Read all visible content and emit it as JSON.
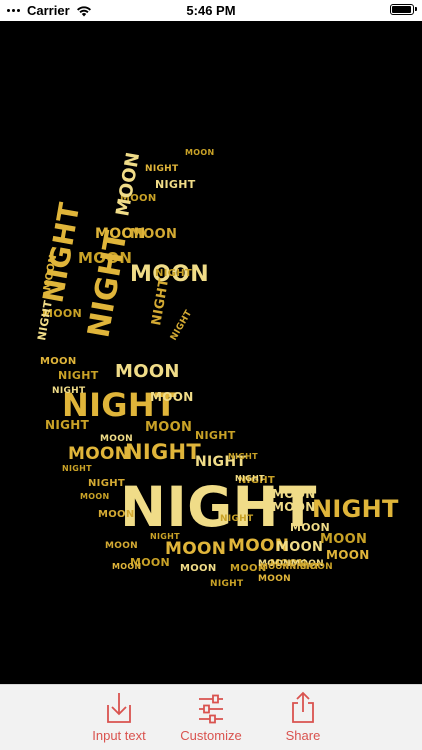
{
  "status_bar": {
    "carrier": "Carrier",
    "time": "5:46 PM",
    "battery_level": 0.95
  },
  "canvas": {
    "background": "#000000",
    "palette": [
      "#c9a227",
      "#e0b53a",
      "#f0dc88",
      "#d4aa33"
    ],
    "word_cloud": [
      {
        "text": "MOON"
      },
      {
        "text": "NIGHT"
      },
      {
        "text": "NIGHT"
      },
      {
        "text": "MOON"
      },
      {
        "text": "MOON"
      },
      {
        "text": "MOON"
      },
      {
        "text": "MOON"
      },
      {
        "text": "NIGHT"
      },
      {
        "text": "MOON"
      },
      {
        "text": "NIGHT"
      },
      {
        "text": "NIGHT"
      },
      {
        "text": "MOON"
      },
      {
        "text": "MOON"
      },
      {
        "text": "NIGHT"
      },
      {
        "text": "NIGHT"
      },
      {
        "text": "MOON"
      },
      {
        "text": "MOON"
      },
      {
        "text": "NIGHT"
      },
      {
        "text": "NIGHT"
      },
      {
        "text": "MOON"
      },
      {
        "text": "NIGHT"
      },
      {
        "text": "MOON"
      },
      {
        "text": "NIGHT"
      },
      {
        "text": "NIGHT"
      },
      {
        "text": "MOON"
      },
      {
        "text": "NIGHT"
      },
      {
        "text": "MOON"
      },
      {
        "text": "NIGHT"
      },
      {
        "text": "NIGHT"
      },
      {
        "text": "MOON"
      },
      {
        "text": "NIGHT"
      },
      {
        "text": "NIGHT"
      },
      {
        "text": "MOON"
      },
      {
        "text": "MOON"
      },
      {
        "text": "NIGHT"
      },
      {
        "text": "NIGHT"
      },
      {
        "text": "MOON"
      },
      {
        "text": "MOON"
      },
      {
        "text": "MOON"
      },
      {
        "text": "MOON"
      },
      {
        "text": "NIGHT"
      },
      {
        "text": "MOON"
      },
      {
        "text": "MOON"
      },
      {
        "text": "MOON"
      },
      {
        "text": "MOON"
      },
      {
        "text": "MOON"
      },
      {
        "text": "MOON"
      },
      {
        "text": "MOONMOON"
      },
      {
        "text": "MOON"
      },
      {
        "text": "MOON"
      },
      {
        "text": "NIGHT"
      },
      {
        "text": "MOON"
      },
      {
        "text": "MOONNIGHT"
      },
      {
        "text": "MOON"
      },
      {
        "text": "MOON"
      },
      {
        "text": "NIGHT"
      },
      {
        "text": "NIGHT"
      },
      {
        "text": "MOON"
      },
      {
        "text": "NIGHT"
      },
      {
        "text": "NIGHT"
      }
    ]
  },
  "toolbar": {
    "accent_color": "#d9534f",
    "items": [
      {
        "label": "Input text",
        "icon": "download-tray-icon"
      },
      {
        "label": "Customize",
        "icon": "sliders-icon"
      },
      {
        "label": "Share",
        "icon": "share-icon"
      }
    ]
  }
}
